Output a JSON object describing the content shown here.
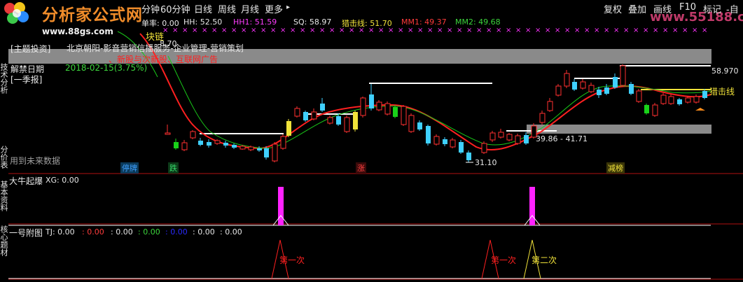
{
  "watermark": {
    "logo_text": "分析家公式网",
    "site_url": "www.88gs.com",
    "right_url": "www.55188.com"
  },
  "toolbar": {
    "period_items": [
      "分钟",
      "60分钟",
      "日线",
      "周线",
      "月线",
      "更多"
    ],
    "period_suffix": "▸",
    "right_items": [
      "复权",
      "叠加",
      "画线",
      "F10",
      "标记",
      "-自"
    ]
  },
  "indicator_bar": {
    "rate_label": "单率: 0.00",
    "hh_label": "HH: 52.50",
    "hh1_label": "HH1: 51.59",
    "sq_label": "SQ: 58.97",
    "attack_label": "猎击线: 51.70",
    "mm1_label": "MM1: 49.37",
    "mm2_label": "MM2: 49.68"
  },
  "info_panel": {
    "partial_top": "块链",
    "partial_value": "8.70",
    "concept_text": "[主题投资]",
    "company_text": "北京朝阳-影音营销信播服务-企业管理-营销策划",
    "release_label": "解禁日期",
    "release_value": "2018-02-15(3.75%)",
    "season_label": "[一季报]",
    "red_line": "、新股与次新股、互联网广告",
    "future_note": "用到未来数据"
  },
  "chart_labels": {
    "price_high": "58.970",
    "price_low": "31.10",
    "range_label": "39.86 - 41.71",
    "attack_line_label": "猎击线"
  },
  "event_tags": [
    {
      "text": "停牌",
      "color": "#3fa0ff"
    },
    {
      "text": "跌",
      "color": "#36d86a"
    },
    {
      "text": "涨",
      "color": "#ff4040"
    },
    {
      "text": "减榜",
      "color": "#f0e23a"
    }
  ],
  "left_tabs": [
    "技术分析",
    "基本资料",
    "分价表",
    "核心题材"
  ],
  "sub1": {
    "title": "大牛起爆",
    "xg_label": "XG: 0.00"
  },
  "sub2": {
    "title": "一号附图",
    "tj_label": "TJ: 0.00",
    "values": [
      {
        "text": ": 0.00",
        "color": "#ff3b3b"
      },
      {
        "text": ": 0.00",
        "color": "#e8e8e8"
      },
      {
        "text": ": 0.00",
        "color": "#3cd63c"
      },
      {
        "text": ": 0.00",
        "color": "#2a2aff"
      },
      {
        "text": ": 0.00",
        "color": "#e8e8e8"
      },
      {
        "text": ": 0.00",
        "color": "#e8e8e8"
      }
    ],
    "signals": [
      "第一次",
      "第一次",
      "第二次"
    ]
  },
  "colors": {
    "up": "#ff3030",
    "down": "#3fd0ff",
    "ma_red": "#ff2020",
    "ma_green": "#19c819",
    "magenta": "#ff33ff"
  }
}
